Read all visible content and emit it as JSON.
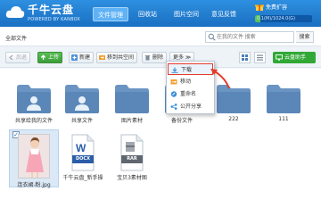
{
  "header": {
    "brand": "千牛云盘",
    "brand_sub": "POWERED BY KANBOX",
    "nav": [
      "文件管理",
      "回收站",
      "图片空间",
      "意见反馈"
    ],
    "upgrade": "免费扩容",
    "storage": "0.1(M)/1024.0(G)",
    "storage_used_fraction": 0.1
  },
  "path": {
    "breadcrumb": "全部文件",
    "search_placeholder": "在我的文件 搜索",
    "search_button": "搜索"
  },
  "toolbar": {
    "back": "后退",
    "upload": "上传",
    "new": "新建",
    "share": "移到共空间",
    "delete": "删除",
    "more": "更多 ≫",
    "assistant": "云盘助手"
  },
  "menu": {
    "items": [
      "下载",
      "移动",
      "重命名",
      "公开分享"
    ]
  },
  "files": [
    {
      "name": "共享给我的文件",
      "type": "folder"
    },
    {
      "name": "共享文件",
      "type": "folder"
    },
    {
      "name": "图片素材",
      "type": "folder"
    },
    {
      "name": "备份文件",
      "type": "folder"
    },
    {
      "name": "222",
      "type": "folder"
    },
    {
      "name": "111",
      "type": "folder"
    },
    {
      "name": "连衣裙-粉.jpg",
      "type": "image",
      "selected": true
    },
    {
      "name": "千牛云盘_新手操",
      "type": "docx",
      "badge": "DOCX"
    },
    {
      "name": "宝贝3素材图",
      "type": "rar",
      "badge": "RAR"
    }
  ],
  "colors": {
    "header": "#2e8fe0",
    "upload": "#3b9d38",
    "folder": "#5a87b8",
    "highlight": "#e43a2c"
  }
}
